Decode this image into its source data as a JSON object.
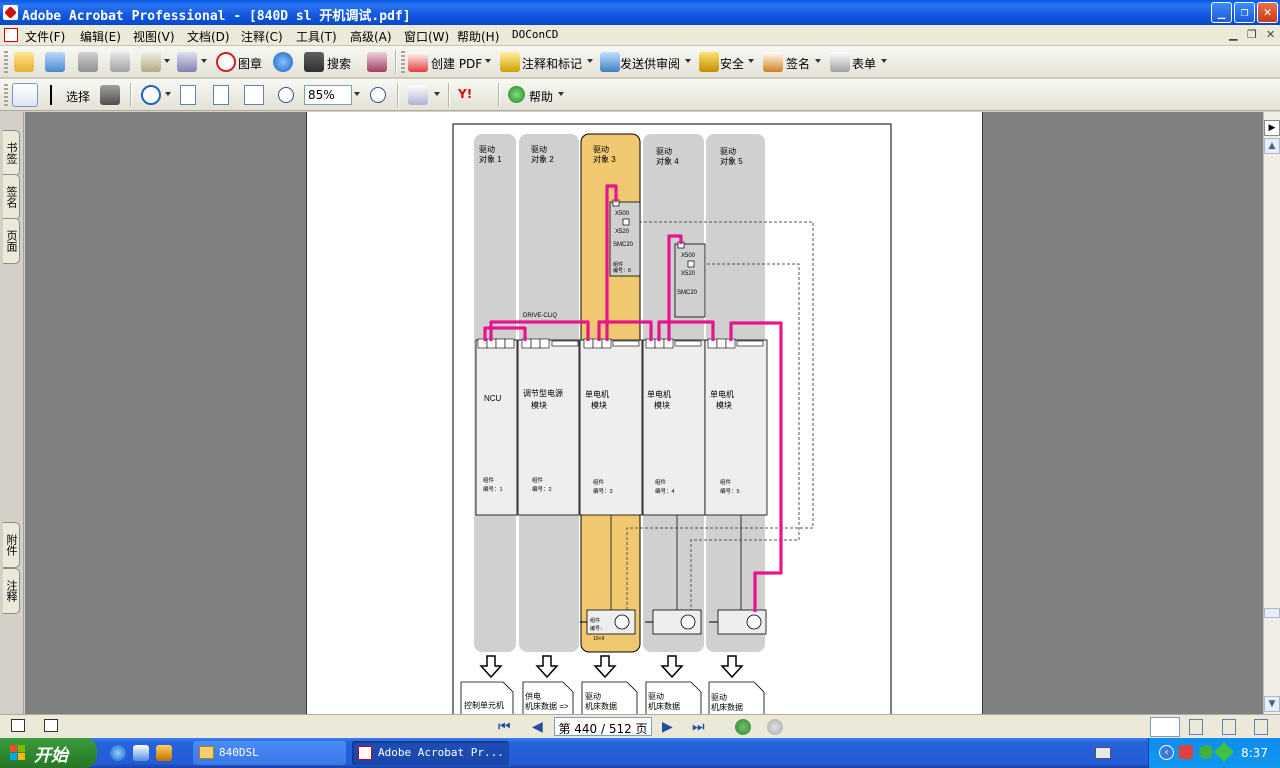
{
  "window": {
    "title": "Adobe Acrobat Professional - [840D sl 开机调试.pdf]",
    "minimize": "_",
    "restore": "❐",
    "close": "✕"
  },
  "menu": [
    "文件(F)",
    "编辑(E)",
    "视图(V)",
    "文档(D)",
    "注释(C)",
    "工具(T)",
    "高级(A)",
    "窗口(W)",
    "帮助(H)",
    "DOConCD"
  ],
  "toolbar1": {
    "stamp": "图章",
    "search": "搜索",
    "create_pdf": "创建 PDF",
    "comment": "注释和标记",
    "send_review": "发送供审阅",
    "security": "安全",
    "sign": "签名",
    "forms": "表单"
  },
  "toolbar2": {
    "select": "选择",
    "zoom": "85%",
    "help": "帮助"
  },
  "side_tabs": {
    "bookmarks": "书签",
    "signatures": "签名",
    "pages": "页面",
    "attachments": "附件",
    "comments": "注释"
  },
  "diagram": {
    "columns": [
      {
        "line1": "驱动",
        "line2": "对象 1"
      },
      {
        "line1": "驱动",
        "line2": "对象 2"
      },
      {
        "line1": "驱动",
        "line2": "对象 3"
      },
      {
        "line1": "驱动",
        "line2": "对象 4"
      },
      {
        "line1": "驱动",
        "line2": "对象 5"
      }
    ],
    "drive_cliq": "DRIVE-CLiQ",
    "smc_a": {
      "x500": "X500",
      "x520": "X520",
      "name": "SMC20",
      "comp1": "组件",
      "comp2": "编号：8"
    },
    "smc_b": {
      "x500": "X500",
      "x520": "X520",
      "name": "SMC20"
    },
    "modules": [
      {
        "name1": "NCU",
        "name2": "",
        "comp1": "组件",
        "comp2": "编号：1"
      },
      {
        "name1": "调节型电源",
        "name2": "模块",
        "comp1": "组件",
        "comp2": "编号：2"
      },
      {
        "name1": "单电机",
        "name2": "模块",
        "comp1": "组件",
        "comp2": "编号：3"
      },
      {
        "name1": "单电机",
        "name2": "模块",
        "comp1": "组件",
        "comp2": "编号：4"
      },
      {
        "name1": "单电机",
        "name2": "模块",
        "comp1": "组件",
        "comp2": "编号：5"
      }
    ],
    "motor_label": {
      "l1": "组件",
      "l2": "编号：",
      "l3": "10+9"
    },
    "bottom_docs": [
      {
        "l1": "",
        "l2": "控制单元机"
      },
      {
        "l1": "供电",
        "l2": "机床数据 =>"
      },
      {
        "l1": "驱动",
        "l2": "机床数据"
      },
      {
        "l1": "驱动",
        "l2": "机床数据"
      },
      {
        "l1": "驱动",
        "l2": "机床数据"
      }
    ]
  },
  "navbar": {
    "page_display": "第 440 / 512 页"
  },
  "taskbar": {
    "start": "开始",
    "task1": "840DSL",
    "task2": "Adobe Acrobat Pr...",
    "clock": "8:37"
  },
  "colors": {
    "magenta": "#e5158c",
    "orange": "#f0c870",
    "column_gray": "#d0d0d0"
  }
}
